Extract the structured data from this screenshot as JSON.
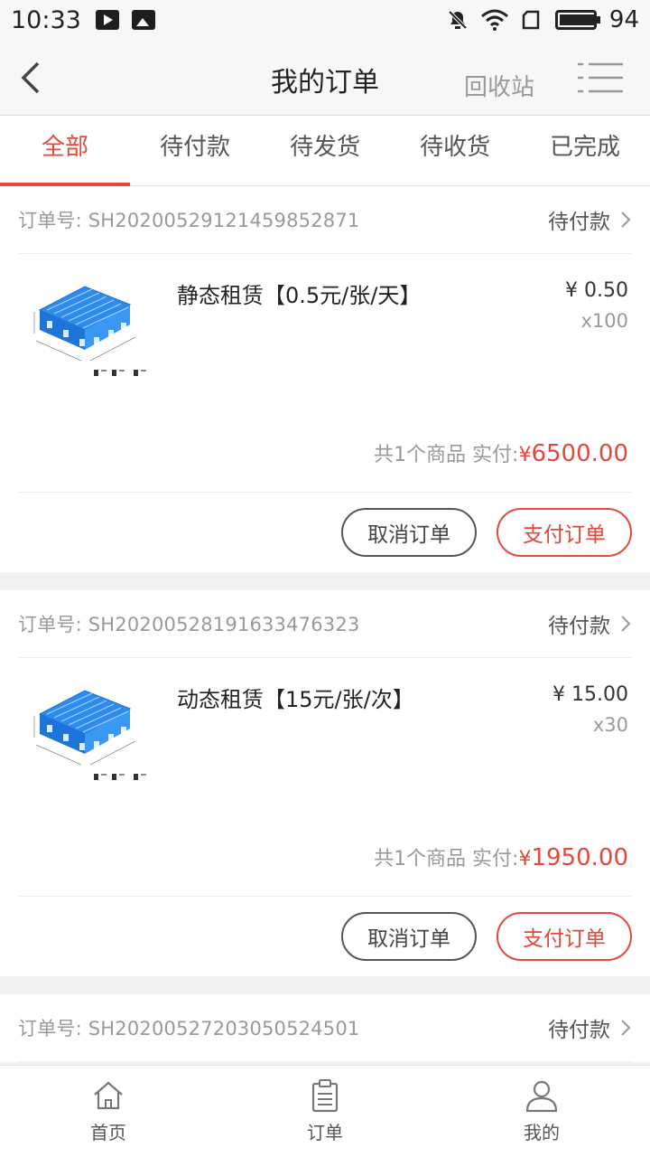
{
  "status_bar": {
    "time": "10:33",
    "battery": "94",
    "battery_level": 0.94
  },
  "navbar": {
    "title": "我的订单",
    "recycle": "回收站"
  },
  "tabs": [
    {
      "label": "全部",
      "active": true
    },
    {
      "label": "待付款",
      "active": false
    },
    {
      "label": "待发货",
      "active": false
    },
    {
      "label": "待收货",
      "active": false
    },
    {
      "label": "已完成",
      "active": false
    }
  ],
  "orders": [
    {
      "number": "订单号: SH20200529121459852871",
      "status": "待付款",
      "item_name": "静态租赁【0.5元/张/天】",
      "price": "¥ 0.50",
      "qty": "x100",
      "summary_prefix": "共1个商品 实付:",
      "currency": "¥ ",
      "total": "6500.00",
      "cancel_label": "取消订单",
      "pay_label": "支付订单"
    },
    {
      "number": "订单号: SH20200528191633476323",
      "status": "待付款",
      "item_name": "动态租赁【15元/张/次】",
      "price": "¥ 15.00",
      "qty": "x30",
      "summary_prefix": "共1个商品 实付:",
      "currency": "¥ ",
      "total": "1950.00",
      "cancel_label": "取消订单",
      "pay_label": "支付订单"
    },
    {
      "number": "订单号: SH20200527203050524501",
      "status": "待付款"
    }
  ],
  "bottom_nav": [
    {
      "label": "首页",
      "icon": "home-icon"
    },
    {
      "label": "订单",
      "icon": "clipboard-icon"
    },
    {
      "label": "我的",
      "icon": "user-icon"
    }
  ],
  "colors": {
    "accent": "#e3483a",
    "pallet": "#2d8bf0"
  }
}
